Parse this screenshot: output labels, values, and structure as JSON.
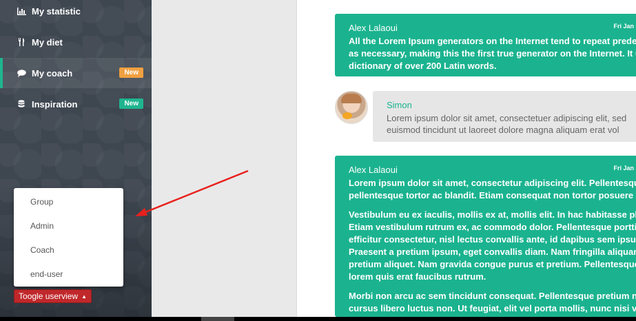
{
  "sidebar": {
    "items": [
      {
        "label": "My statistic",
        "icon": "bar-chart-icon"
      },
      {
        "label": "My diet",
        "icon": "cutlery-icon"
      },
      {
        "label": "My coach",
        "icon": "speech-bubble-icon",
        "badge": "New",
        "badge_color": "#f0a040",
        "active": true
      },
      {
        "label": "Inspiration",
        "icon": "database-icon",
        "badge": "New",
        "badge_color": "#1fb58f"
      }
    ]
  },
  "userview": {
    "options": [
      "Group",
      "Admin",
      "Coach",
      "end-user"
    ],
    "toggle_label": "Toogle userview"
  },
  "messages": [
    {
      "author": "Alex Lalaoui",
      "time": "Fri Jan",
      "paragraphs": [
        [
          "All the Lorem Ipsum generators on the Internet tend to repeat predet",
          "as necessary, making this the first true generator on the Internet. It u",
          "dictionary of over 200 Latin words."
        ]
      ]
    },
    {
      "author": "Simon",
      "avatar": "woman-avatar",
      "paragraphs": [
        [
          "Lorem ipsum dolor sit amet, consectetuer adipiscing elit, sed",
          "euismod tincidunt ut laoreet dolore magna aliquam erat vol"
        ]
      ]
    },
    {
      "author": "Alex Lalaoui",
      "time": "Fri Jan",
      "paragraphs": [
        [
          "Lorem ipsum dolor sit amet, consectetur adipiscing elit. Pellentesque",
          "pellentesque tortor ac blandit. Etiam consequat non tortor posuere c"
        ],
        [
          "Vestibulum eu ex iaculis, mollis ex at, mollis elit. In hac habitasse plat",
          "Etiam vestibulum rutrum ex, ac commodo dolor. Pellentesque porttit",
          "efficitur consectetur, nisl lectus convallis ante, id dapibus sem ipsum",
          "Praesent a pretium ipsum, eget convallis diam. Nam fringilla aliquam",
          "pretium aliquet. Nam gravida congue purus et pretium. Pellentesque",
          "lorem quis erat faucibus rutrum."
        ],
        [
          "Morbi non arcu ac sem tincidunt consequat. Pellentesque pretium nu",
          "cursus libero luctus non. Ut feugiat, elit vel porta mollis, nunc nisi volu"
        ]
      ]
    }
  ],
  "annotation": {
    "arrow_color": "#e8211d"
  },
  "colors": {
    "accent": "#1bb38f",
    "sidebar": "#3e4650",
    "toggle": "#c0282b"
  }
}
